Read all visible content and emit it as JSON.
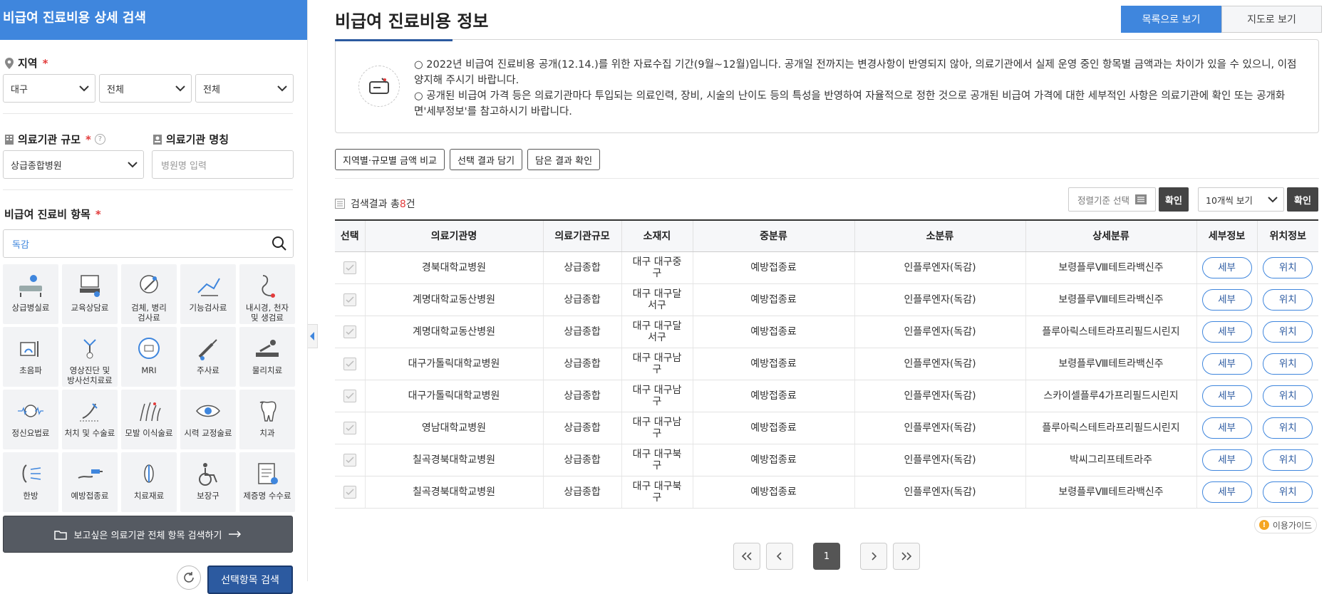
{
  "sidebar": {
    "title": "비급여 진료비용 상세 검색",
    "region": {
      "label": "지역",
      "required": "*",
      "selects": [
        "대구",
        "전체",
        "전체"
      ]
    },
    "scale": {
      "label": "의료기관 규모",
      "required": "*",
      "help": "?",
      "value": "상급종합병원"
    },
    "name": {
      "label": "의료기관 명칭",
      "placeholder": "병원명 입력"
    },
    "items_section": {
      "label": "비급여 진료비 항목",
      "required": "*",
      "search_value": "독감"
    },
    "categories": [
      {
        "label": "상급병실료",
        "icon": "hospital-bed-icon"
      },
      {
        "label": "교육상담료",
        "icon": "counseling-icon"
      },
      {
        "label": "검체, 병리\n검사료",
        "icon": "microscope-icon"
      },
      {
        "label": "기능검사료",
        "icon": "function-test-icon"
      },
      {
        "label": "내시경, 천자\n및 생검료",
        "icon": "endoscope-icon"
      },
      {
        "label": "초음파",
        "icon": "ultrasound-icon"
      },
      {
        "label": "영상진단 및\n방사선치료료",
        "icon": "radiology-icon"
      },
      {
        "label": "MRI",
        "icon": "mri-icon"
      },
      {
        "label": "주사료",
        "icon": "syringe-icon"
      },
      {
        "label": "물리치료",
        "icon": "physical-therapy-icon"
      },
      {
        "label": "정신요법료",
        "icon": "brain-wave-icon"
      },
      {
        "label": "처치 및 수술료",
        "icon": "scalpel-icon"
      },
      {
        "label": "모발 이식술료",
        "icon": "hair-transplant-icon"
      },
      {
        "label": "시력 교정술료",
        "icon": "eye-icon"
      },
      {
        "label": "치과",
        "icon": "tooth-icon"
      },
      {
        "label": "한방",
        "icon": "acupuncture-icon"
      },
      {
        "label": "예방접종료",
        "icon": "vaccine-icon"
      },
      {
        "label": "치료재료",
        "icon": "medical-material-icon"
      },
      {
        "label": "보장구",
        "icon": "wheelchair-icon"
      },
      {
        "label": "제증명 수수료",
        "icon": "certificate-icon"
      }
    ],
    "all_items_button": "보고싶은 의료기관 전체 항목 검색하기",
    "search_button": "선택항목 검색"
  },
  "main": {
    "title": "비급여 진료비용 정보",
    "view_tabs": [
      "목록으로 보기",
      "지도로 보기"
    ],
    "notice_lines": [
      "○ 2022년 비급여 진료비용 공개(12.14.)를 위한 자료수집 기간(9월~12월)입니다. 공개일 전까지는 변경사항이 반영되지 않아, 의료기관에서 실제 운영 중인 항목별 금액과는 차이가 있을 수 있으니, 이점 양지해 주시기 바랍니다.",
      "○ 공개된 비급여 가격 등은 의료기관마다 투입되는 의료인력, 장비, 시술의 난이도 등의 특성을 반영하여 자율적으로 정한 것으로 공개된 비급여 가격에 대한 세부적인 사항은 의료기관에 확인 또는 공개화면'세부정보'를 참고하시기 바랍니다."
    ],
    "action_buttons": [
      "지역별·규모별 금액 비교",
      "선택 결과 담기",
      "담은 결과 확인"
    ],
    "result_prefix": "검색결과 총",
    "result_count": "8",
    "result_suffix": "건",
    "sort_label": "정렬기준 선택",
    "confirm": "확인",
    "per_page": "10개씩 보기",
    "table": {
      "headers": [
        "선택",
        "의료기관명",
        "의료기관규모",
        "소재지",
        "중분류",
        "소분류",
        "상세분류",
        "세부정보",
        "위치정보"
      ],
      "rows": [
        {
          "name": "경북대학교병원",
          "scale": "상급종합",
          "location": "대구 대구중구",
          "mid": "예방접종료",
          "sub": "인플루엔자(독감)",
          "detail": "보령플루Ⅷ테트라백신주"
        },
        {
          "name": "계명대학교동산병원",
          "scale": "상급종합",
          "location": "대구 대구달서구",
          "mid": "예방접종료",
          "sub": "인플루엔자(독감)",
          "detail": "보령플루Ⅷ테트라백신주"
        },
        {
          "name": "계명대학교동산병원",
          "scale": "상급종합",
          "location": "대구 대구달서구",
          "mid": "예방접종료",
          "sub": "인플루엔자(독감)",
          "detail": "플루아릭스테트라프리필드시린지"
        },
        {
          "name": "대구가톨릭대학교병원",
          "scale": "상급종합",
          "location": "대구 대구남구",
          "mid": "예방접종료",
          "sub": "인플루엔자(독감)",
          "detail": "보령플루Ⅷ테트라백신주"
        },
        {
          "name": "대구가톨릭대학교병원",
          "scale": "상급종합",
          "location": "대구 대구남구",
          "mid": "예방접종료",
          "sub": "인플루엔자(독감)",
          "detail": "스카이셀플루4가프리필드시린지"
        },
        {
          "name": "영남대학교병원",
          "scale": "상급종합",
          "location": "대구 대구남구",
          "mid": "예방접종료",
          "sub": "인플루엔자(독감)",
          "detail": "플루아릭스테트라프리필드시린지"
        },
        {
          "name": "칠곡경북대학교병원",
          "scale": "상급종합",
          "location": "대구 대구북구",
          "mid": "예방접종료",
          "sub": "인플루엔자(독감)",
          "detail": "박씨그리프테트라주"
        },
        {
          "name": "칠곡경북대학교병원",
          "scale": "상급종합",
          "location": "대구 대구북구",
          "mid": "예방접종료",
          "sub": "인플루엔자(독감)",
          "detail": "보령플루Ⅷ테트라백신주"
        }
      ],
      "detail_btn": "세부",
      "location_btn": "위치"
    },
    "guide_label": "이용가이드",
    "guide_icon": "!",
    "pagination": {
      "current": "1"
    }
  },
  "colors": {
    "brand": "#3f86dd",
    "accent_red": "#e23b3b",
    "dark": "#444444"
  }
}
